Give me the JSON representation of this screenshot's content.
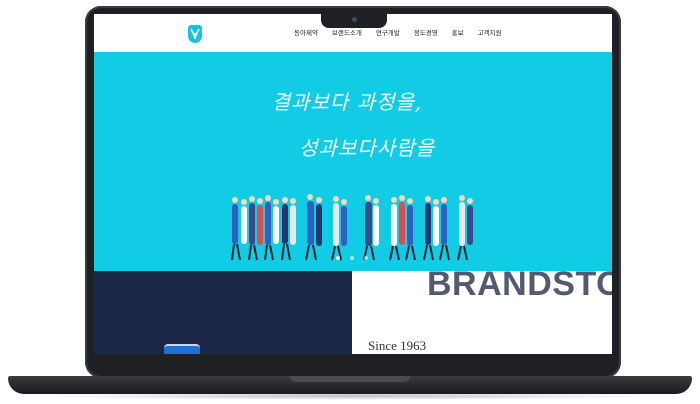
{
  "nav": {
    "menu": [
      "동아제약",
      "브랜드소개",
      "연구개발",
      "정도경영",
      "홍보",
      "고객지원"
    ]
  },
  "hero": {
    "slogan_line1": "결과보다 과정을,",
    "slogan_line2": "성과보다사람을",
    "slide_count": 3,
    "active_slide": 1
  },
  "story": {
    "heading": "BRANDSTORY",
    "since": "Since 1963"
  },
  "colors": {
    "hero_bg": "#12cbe4",
    "story_left_bg": "#1c2748",
    "brand_text": "#535a6f"
  }
}
